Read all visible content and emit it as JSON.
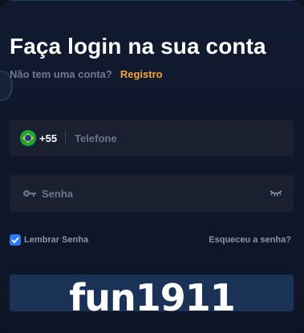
{
  "header": {
    "title": "Faça login na sua conta",
    "no_account": "Não tem uma conta?",
    "register_link": "Registro"
  },
  "phone_field": {
    "flag_icon": "brazil-flag-icon",
    "country_code": "+55",
    "placeholder": "Telefone",
    "value": ""
  },
  "password_field": {
    "icon": "key-icon",
    "placeholder": "Senha",
    "toggle_icon": "eye-closed-icon",
    "value": ""
  },
  "options": {
    "remember_label": "Lembrar Senha",
    "remember_checked": true,
    "forgot_link": "Esqueceu a senha?"
  },
  "watermark": "fun1911",
  "colors": {
    "accent": "#f6a53a",
    "checkbox": "#2b7cf2",
    "button": "#1b3257",
    "background": "#111a30"
  }
}
